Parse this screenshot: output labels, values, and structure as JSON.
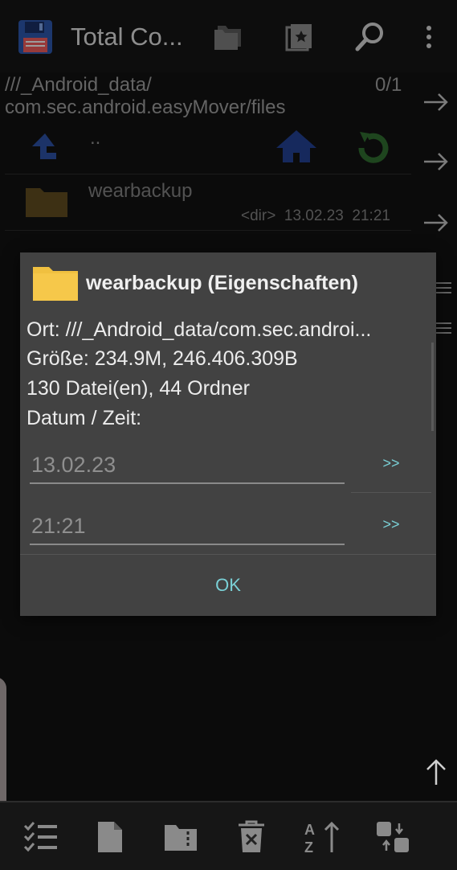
{
  "appbar": {
    "title": "Total Co..."
  },
  "path": {
    "text": "///_Android_data/\ncom.sec.android.easyMover/files",
    "line1": "///_Android_data/",
    "line2": "com.sec.android.easyMover/files",
    "count": "0/1"
  },
  "listing": {
    "updir_label": "..",
    "items": [
      {
        "name": "wearbackup",
        "type": "<dir>",
        "date": "13.02.23",
        "time": "21:21"
      }
    ]
  },
  "dialog": {
    "title": "wearbackup (Eigenschaften)",
    "location": "Ort: ///_Android_data/com.sec.androi...",
    "size": "Größe: 234.9M, 246.406.309B",
    "counts": "130 Datei(en), 44 Ordner",
    "datetime_label": "Datum / Zeit:",
    "date_value": "13.02.23",
    "time_value": "21:21",
    "date_button": ">>",
    "time_button": ">>",
    "ok_label": "OK"
  },
  "icons": {
    "save": "floppy-disk-icon",
    "folders": "folders-icon",
    "bookmark": "bookmark-star-icon",
    "search": "search-icon",
    "more": "more-vert-icon",
    "up": "up-arrow-icon",
    "home": "home-icon",
    "refresh": "refresh-icon",
    "folder": "folder-icon"
  },
  "colors": {
    "accent": "#7ad0d6",
    "folder": "#f0c040",
    "home": "#1e3a8a",
    "refresh": "#2e7d32",
    "background": "#121212",
    "dialog": "#424242"
  }
}
